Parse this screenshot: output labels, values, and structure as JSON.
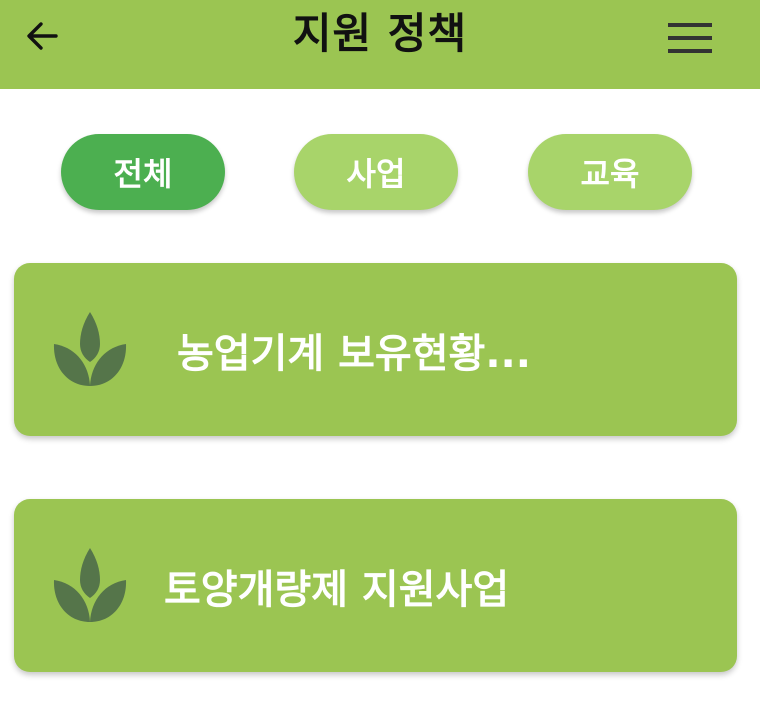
{
  "header": {
    "title": "지원 정책",
    "back_icon": "arrow-left-icon",
    "menu_icon": "hamburger-menu-icon",
    "background_color": "#9bc552"
  },
  "tabs": [
    {
      "label": "전체",
      "selected": true,
      "color": "#4caf50"
    },
    {
      "label": "사업",
      "selected": false,
      "color": "#a8d46a"
    },
    {
      "label": "교육",
      "selected": false,
      "color": "#a8d46a"
    }
  ],
  "cards": [
    {
      "label": "농업기계 보유현황...",
      "icon": "sprout-icon"
    },
    {
      "label": "토양개량제 지원사업",
      "icon": "sprout-icon"
    }
  ],
  "colors": {
    "card_background": "#9bc552",
    "icon_color": "#55754a"
  }
}
